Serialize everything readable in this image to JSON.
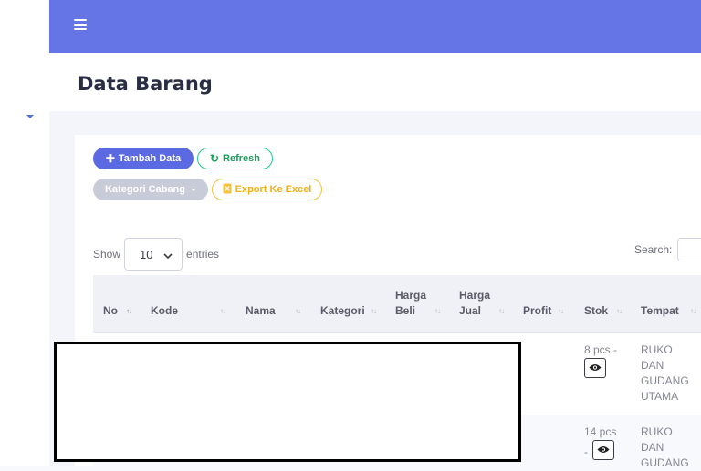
{
  "header": {
    "page_title": "Data Barang"
  },
  "toolbar": {
    "add_label": "Tambah Data",
    "refresh_label": "Refresh",
    "kategori_label": "Kategori Cabang",
    "export_label": "Export Ke Excel"
  },
  "length": {
    "show_label": "Show",
    "value": "10",
    "entries_label": "entries"
  },
  "search": {
    "label": "Search:"
  },
  "table": {
    "columns": [
      {
        "line1": "No",
        "line2": ""
      },
      {
        "line1": "Kode",
        "line2": ""
      },
      {
        "line1": "Nama",
        "line2": ""
      },
      {
        "line1": "Kategori",
        "line2": ""
      },
      {
        "line1": "Harga",
        "line2": "Beli"
      },
      {
        "line1": "Harga",
        "line2": "Jual"
      },
      {
        "line1": "Profit",
        "line2": ""
      },
      {
        "line1": "Stok",
        "line2": ""
      },
      {
        "line1": "Tempat",
        "line2": ""
      }
    ],
    "rows": [
      {
        "stok_line1": "8 pcs -",
        "stok_line2": "",
        "tempat": [
          "RUKO",
          "DAN",
          "GUDANG",
          "UTAMA"
        ]
      },
      {
        "stok_line1": "14 pcs",
        "stok_line2": "-",
        "tempat": [
          "RUKO",
          "DAN",
          "GUDANG"
        ]
      }
    ]
  },
  "colors": {
    "topbar": "#6675e5",
    "primary": "#5b6ae3",
    "success": "#1cc88a",
    "warning": "#f6c23e",
    "secondary": "#c8ccd8"
  },
  "icons": {
    "menu": "hamburger-icon",
    "add": "plus-icon",
    "refresh": "redo-icon",
    "excel": "file-excel-icon",
    "view": "eye-icon"
  }
}
